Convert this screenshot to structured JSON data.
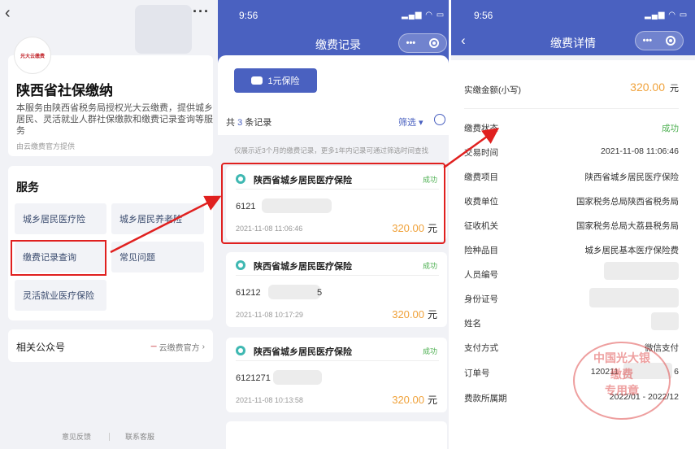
{
  "panel1": {
    "logo_text": "光大云缴费",
    "title": "陕西省社保缴纳",
    "description": "本服务由陕西省税务局授权光大云缴费，提供城乡居民、灵活就业人群社保缴款和缴费记录查询等服务",
    "provider": "由云缴费官方提供",
    "services_title": "服务",
    "services": [
      "城乡居民医疗险",
      "城乡居民养老险",
      "缴费记录查询",
      "常见问题",
      "灵活就业医疗保险"
    ],
    "related_label": "相关公众号",
    "related_value": "云缴费官方",
    "footer": [
      "意见反馈",
      "联系客服"
    ]
  },
  "panel2": {
    "time": "9:56",
    "nav_title": "缴费记录",
    "insurance_button": "1元保险",
    "count_prefix": "共",
    "count_value": "3",
    "count_suffix": "条记录",
    "filter_label": "筛选",
    "hint": "仅展示近3个月的缴费记录，更多1年内记录可通过筛选时间查找",
    "records": [
      {
        "name": "陕西省城乡居民医疗保险",
        "status": "成功",
        "account": "6121",
        "time": "2021-11-08 11:06:46",
        "amount": "320.00",
        "unit": "元"
      },
      {
        "name": "陕西省城乡居民医疗保险",
        "status": "成功",
        "account": "61212",
        "account_tail": "5",
        "time": "2021-11-08 10:17:29",
        "amount": "320.00",
        "unit": "元"
      },
      {
        "name": "陕西省城乡居民医疗保险",
        "status": "成功",
        "account": "6121271",
        "time": "2021-11-08 10:13:58",
        "amount": "320.00",
        "unit": "元"
      }
    ]
  },
  "panel3": {
    "time": "9:56",
    "nav_title": "缴费详情",
    "amount_label": "实缴金额(小写)",
    "amount": "320.00",
    "amount_unit": "元",
    "fields": [
      {
        "label": "缴费状态",
        "value": "成功"
      },
      {
        "label": "交易时间",
        "value": "2021-11-08 11:06:46"
      },
      {
        "label": "缴费项目",
        "value": "陕西省城乡居民医疗保险"
      },
      {
        "label": "收费单位",
        "value": "国家税务总局陕西省税务局"
      },
      {
        "label": "征收机关",
        "value": "国家税务总局大荔县税务局"
      },
      {
        "label": "险种品目",
        "value": "城乡居民基本医疗保险费"
      },
      {
        "label": "人员编号",
        "value": ""
      },
      {
        "label": "身份证号",
        "value": ""
      },
      {
        "label": "姓名",
        "value": ""
      },
      {
        "label": "支付方式",
        "value": "微信支付"
      },
      {
        "label": "订单号",
        "value": "120211",
        "tail": "6"
      },
      {
        "label": "费款所属期",
        "value": "2022/01 - 2022/12"
      }
    ],
    "seal_text": [
      "中国光大银",
      "缴费",
      "专用章"
    ]
  },
  "colors": {
    "brand_blue": "#4a61c0",
    "amount_orange": "#f0a23b",
    "success_green": "#4caf50",
    "highlight_red": "#e0201f"
  }
}
